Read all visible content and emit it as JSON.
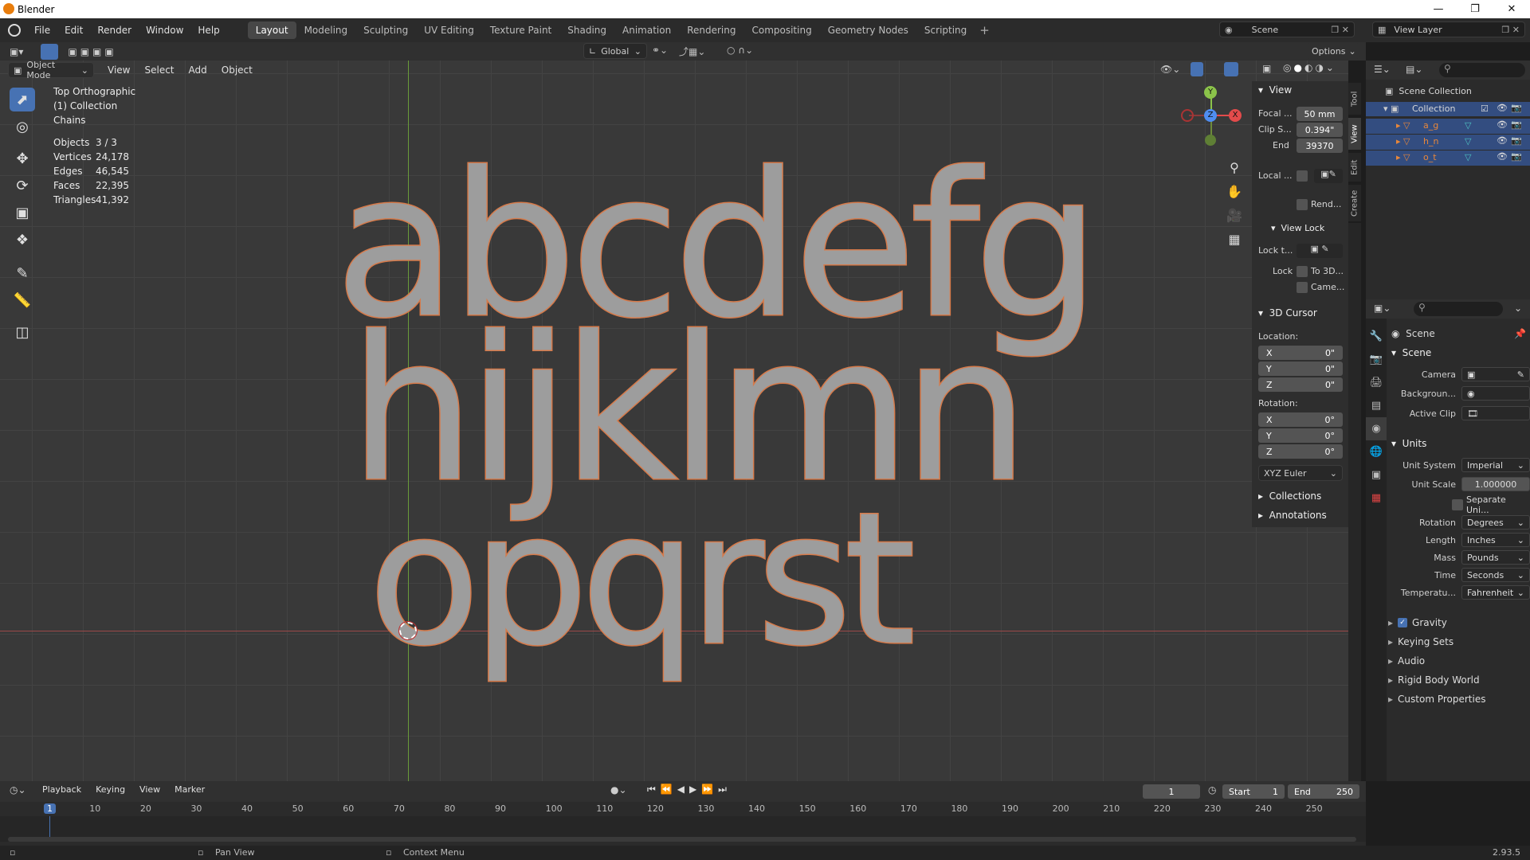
{
  "app": {
    "title": "Blender",
    "version": "2.93.5"
  },
  "menus": [
    "File",
    "Edit",
    "Render",
    "Window",
    "Help"
  ],
  "workspaces": [
    "Layout",
    "Modeling",
    "Sculpting",
    "UV Editing",
    "Texture Paint",
    "Shading",
    "Animation",
    "Rendering",
    "Compositing",
    "Geometry Nodes",
    "Scripting"
  ],
  "active_workspace": "Layout",
  "scene_name": "Scene",
  "view_layer": "View Layer",
  "viewport_header": {
    "mode": "Object Mode",
    "menus": [
      "View",
      "Select",
      "Add",
      "Object"
    ],
    "transform": "Global",
    "options": "Options"
  },
  "viewport_info": {
    "view": "Top Orthographic",
    "collection": "(1) Collection",
    "object": "Chains",
    "stats": [
      {
        "label": "Objects",
        "value": "3 / 3"
      },
      {
        "label": "Vertices",
        "value": "24,178"
      },
      {
        "label": "Edges",
        "value": "46,545"
      },
      {
        "label": "Faces",
        "value": "22,395"
      },
      {
        "label": "Triangles",
        "value": "41,392"
      }
    ]
  },
  "letters": {
    "row1": "abcdefg",
    "row2": "hijklmn",
    "row3": "opqrst"
  },
  "gizmo": {
    "y": "Y",
    "z": "Z",
    "x": "X"
  },
  "npanel": {
    "view_header": "View",
    "focal_label": "Focal ...",
    "focal": "50 mm",
    "clip_label": "Clip S...",
    "clip": "0.394\"",
    "end_label": "End",
    "end": "39370",
    "local_label": "Local ...",
    "rend_label": "Rend...",
    "viewlock_header": "View Lock",
    "lock_to_label": "Lock t...",
    "lock_label": "Lock",
    "to3d": "To 3D...",
    "camera": "Came...",
    "cursor_header": "3D Cursor",
    "location": "Location:",
    "rotation": "Rotation:",
    "loc": [
      {
        "axis": "X",
        "v": "0\""
      },
      {
        "axis": "Y",
        "v": "0\""
      },
      {
        "axis": "Z",
        "v": "0\""
      }
    ],
    "rot": [
      {
        "axis": "X",
        "v": "0°"
      },
      {
        "axis": "Y",
        "v": "0°"
      },
      {
        "axis": "Z",
        "v": "0°"
      }
    ],
    "euler": "XYZ Euler",
    "collections": "Collections",
    "annotations": "Annotations",
    "tabs": [
      "Tool",
      "View",
      "Edit",
      "Create"
    ]
  },
  "outliner": {
    "root": "Scene Collection",
    "collection": "Collection",
    "objects": [
      "a_g",
      "h_n",
      "o_t"
    ]
  },
  "properties": {
    "context": "Scene",
    "scene_header": "Scene",
    "camera": "Camera",
    "background": "Backgroun...",
    "active_clip": "Active Clip",
    "units_header": "Units",
    "units": [
      {
        "label": "Unit System",
        "value": "Imperial"
      },
      {
        "label": "Unit Scale",
        "value": "1.000000"
      }
    ],
    "separate_units": "Separate Uni...",
    "units2": [
      {
        "label": "Rotation",
        "value": "Degrees"
      },
      {
        "label": "Length",
        "value": "Inches"
      },
      {
        "label": "Mass",
        "value": "Pounds"
      },
      {
        "label": "Time",
        "value": "Seconds"
      },
      {
        "label": "Temperatu...",
        "value": "Fahrenheit"
      }
    ],
    "panels": [
      "Gravity",
      "Keying Sets",
      "Audio",
      "Rigid Body World",
      "Custom Properties"
    ]
  },
  "timeline": {
    "menus": [
      "Playback",
      "Keying",
      "View",
      "Marker"
    ],
    "current": "1",
    "start_label": "Start",
    "start": "1",
    "end_label": "End",
    "end": "250",
    "ticks": [
      "1",
      "10",
      "20",
      "30",
      "40",
      "50",
      "60",
      "70",
      "80",
      "90",
      "100",
      "110",
      "120",
      "130",
      "140",
      "150",
      "160",
      "170",
      "180",
      "190",
      "200",
      "210",
      "220",
      "230",
      "240",
      "250"
    ]
  },
  "status": {
    "pan": "Pan View",
    "context": "Context Menu"
  }
}
